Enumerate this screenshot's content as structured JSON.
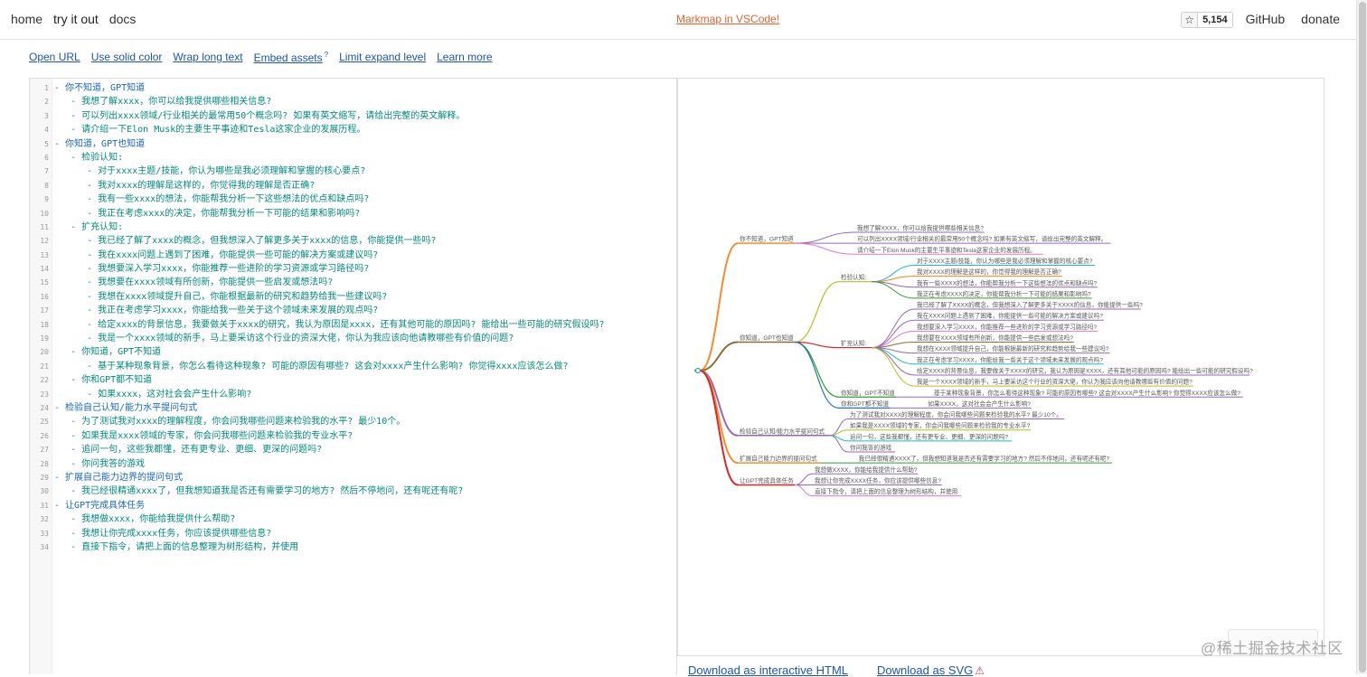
{
  "nav": {
    "left": [
      "home",
      "try it out",
      "docs"
    ],
    "center_link": "Markmap in VSCode!",
    "star_count": "5,154",
    "right": [
      "GitHub",
      "donate"
    ]
  },
  "toolbar": {
    "items": [
      "Open URL",
      "Use solid color",
      "Wrap long text",
      "Embed assets",
      "Limit expand level",
      "Learn more"
    ],
    "embed_badge": "?"
  },
  "editor": {
    "lines": [
      {
        "n": "1",
        "indent": 0,
        "text": "你不知道，GPT知道"
      },
      {
        "n": "2",
        "indent": 1,
        "text": "我想了解xxxx，你可以给我提供哪些相关信息?"
      },
      {
        "n": "3",
        "indent": 1,
        "text": "可以列出xxxx领域/行业相关的最常用50个概念吗? 如果有英文缩写，请给出完整的英文解释。"
      },
      {
        "n": "4",
        "indent": 1,
        "text": "请介绍一下Elon Musk的主要生平事迹和Tesla这家企业的发展历程。"
      },
      {
        "n": "5",
        "indent": 0,
        "text": "你知道，GPT也知道"
      },
      {
        "n": "6",
        "indent": 1,
        "text": "检验认知:"
      },
      {
        "n": "7",
        "indent": 2,
        "text": "对于xxxx主题/技能，你认为哪些是我必须理解和掌握的核心要点?"
      },
      {
        "n": "8",
        "indent": 2,
        "text": "我对xxxx的理解是这样的，你觉得我的理解是否正确?"
      },
      {
        "n": "9",
        "indent": 2,
        "text": "我有一些xxxx的想法，你能帮我分析一下这些想法的优点和缺点吗?"
      },
      {
        "n": "10",
        "indent": 2,
        "text": "我正在考虑xxxx的决定，你能帮我分析一下可能的结果和影响吗?"
      },
      {
        "n": "11",
        "indent": 1,
        "text": "扩充认知:"
      },
      {
        "n": "12",
        "indent": 2,
        "text": "我已经了解了xxxx的概念，但我想深入了解更多关于xxxx的信息，你能提供一些吗?"
      },
      {
        "n": "13",
        "indent": 2,
        "text": "我在xxxx问题上遇到了困难，你能提供一些可能的解决方案或建议吗?"
      },
      {
        "n": "14",
        "indent": 2,
        "text": "我想要深入学习xxxx，你能推荐一些进阶的学习资源或学习路径吗?"
      },
      {
        "n": "15",
        "indent": 2,
        "text": "我想要在xxxx领域有所创新，你能提供一些启发或想法吗?"
      },
      {
        "n": "16",
        "indent": 2,
        "text": "我想在xxxx领域提升自己，你能根据最新的研究和趋势给我一些建议吗?"
      },
      {
        "n": "17",
        "indent": 2,
        "text": "我正在考虑学习xxxx，你能给我一些关于这个领域未来发展的观点吗?"
      },
      {
        "n": "18",
        "indent": 2,
        "text": "给定xxxx的背景信息，我要做关于xxxx的研究，我认为原因是xxxx，还有其他可能的原因吗? 能给出一些可能的研究假设吗?"
      },
      {
        "n": "19",
        "indent": 2,
        "text": "我是一个xxxx领域的新手，马上要采访这个行业的资深大佬，你认为我应该向他请教哪些有价值的问题?"
      },
      {
        "n": "20",
        "indent": 1,
        "text": "你知道，GPT不知道"
      },
      {
        "n": "21",
        "indent": 2,
        "text": "基于某种现象背景，你怎么看待这种现象? 可能的原因有哪些? 这会对xxxx产生什么影响? 你觉得xxxx应该怎么做?"
      },
      {
        "n": "22",
        "indent": 1,
        "text": "你和GPT都不知道"
      },
      {
        "n": "23",
        "indent": 2,
        "text": "如果xxxx，这对社会会产生什么影响?"
      },
      {
        "n": "24",
        "indent": 0,
        "text": "检验自己认知/能力水平提问句式"
      },
      {
        "n": "25",
        "indent": 1,
        "text": "为了测试我对xxxx的理解程度，你会问我哪些问题来检验我的水平? 最少10个。"
      },
      {
        "n": "26",
        "indent": 1,
        "text": "如果我是xxxx领域的专家，你会问我哪些问题来检验我的专业水平?"
      },
      {
        "n": "27",
        "indent": 1,
        "text": "追问一句，这些我都懂，还有更专业、更细、更深的问题吗?"
      },
      {
        "n": "28",
        "indent": 1,
        "text": "你问我答的游戏"
      },
      {
        "n": "29",
        "indent": 0,
        "text": "扩展自己能力边界的提问句式"
      },
      {
        "n": "30",
        "indent": 1,
        "text": "我已经很精通xxxx了，但我想知道我是否还有需要学习的地方? 然后不停地问，还有呢还有呢?"
      },
      {
        "n": "31",
        "indent": 0,
        "text": "让GPT完成具体任务"
      },
      {
        "n": "32",
        "indent": 1,
        "text": "我想做xxxx，你能给我提供什么帮助?"
      },
      {
        "n": "33",
        "indent": 1,
        "text": "我想让你完成xxxx任务，你应该提供哪些信息?"
      },
      {
        "n": "34",
        "indent": 1,
        "text": "直接下指令，请把上面的信息整理为树形结构，并使用"
      }
    ]
  },
  "mindmap": {
    "colors": {
      "b1": "#f28e2c",
      "b2": "#8c6d31",
      "b3": "#9467bd",
      "b4": "#d62728",
      "b5": "#bcbd22",
      "leaf_a": "#e377c2",
      "leaf_b": "#17becf",
      "leaf_c": "#9467bd",
      "leaf_d": "#2ca02c",
      "leaf_e": "#1f77b4",
      "leaf_f": "#ff7f0e"
    },
    "branches": [
      {
        "label": "你不知道，GPT知道",
        "color": "#f28e2c",
        "leaves": [
          {
            "label": "我想了解XXXX，你可以给我提供哪些相关信息?",
            "color": "#9467bd"
          },
          {
            "label": "可以列出XXXX领域/行业相关的最常用50个概念吗? 如果有英文缩写，请给出完整的英文解释。",
            "color": "#9467bd"
          },
          {
            "label": "请介绍一下Elon Musk的主要生平事迹和Tesla这家企业的发展历程。",
            "color": "#e377c2"
          }
        ]
      },
      {
        "label": "你知道，GPT也知道",
        "color": "#8c6d31",
        "subs": [
          {
            "label": "检验认知:",
            "color": "#bcbd22",
            "leaves": [
              {
                "label": "对于XXXX主题/技能，你认为哪些是我必须理解和掌握的核心要点?",
                "color": "#17becf"
              },
              {
                "label": "我对XXXX的理解是这样的，你觉得我的理解是否正确?",
                "color": "#ff7f0e"
              },
              {
                "label": "我有一些XXXX的想法，你能帮我分析一下这些想法的优点和缺点吗?",
                "color": "#9467bd"
              },
              {
                "label": "我正在考虑XXXX的决定，你能帮我分析一下可能的结果和影响吗?",
                "color": "#2ca02c"
              }
            ]
          },
          {
            "label": "扩充认知:",
            "color": "#d62728",
            "leaves": [
              {
                "label": "我已经了解了XXXX的概念，但我想深入了解更多关于XXXX的信息，你能提供一些吗?",
                "color": "#9467bd"
              },
              {
                "label": "我在XXXX问题上遇到了困难，你能提供一些可能的解决方案或建议吗?",
                "color": "#9467bd"
              },
              {
                "label": "我想要深入学习XXXX，你能推荐一些进阶的学习资源或学习路径吗?",
                "color": "#e377c2"
              },
              {
                "label": "我想要在XXXX领域有所创新，你能提供一些启发或想法吗?",
                "color": "#8c6d31"
              },
              {
                "label": "我想在XXXX领域提升自己，你能根据最新的研究和趋势给我一些建议吗?",
                "color": "#9467bd"
              },
              {
                "label": "我正在考虑学习XXXX，你能给我一些关于这个领域未来发展的观点吗?",
                "color": "#17becf"
              },
              {
                "label": "给定XXXX的背景信息，我要做关于XXXX的研究，我认为原因是XXXX，还有其他可能的原因吗? 能给出一些可能的研究假设吗?",
                "color": "#9467bd"
              },
              {
                "label": "我是一个XXXX领域的新手，马上要采访这个行业的资深大佬，你认为我应该向他请教哪些有价值的问题?",
                "color": "#bcbd22"
              }
            ]
          },
          {
            "label": "你知道，GPT不知道",
            "color": "#2ca02c",
            "leaves": [
              {
                "label": "基于某种现象背景，你怎么看待这种现象? 可能的原因有哪些? 这会对XXXX产生什么影响? 你觉得XXXX应该怎么做?",
                "color": "#9467bd"
              }
            ]
          },
          {
            "label": "你和GPT都不知道",
            "color": "#1f77b4",
            "leaves": [
              {
                "label": "如果XXXX，这对社会会产生什么影响?",
                "color": "#9467bd"
              }
            ]
          }
        ]
      },
      {
        "label": "检验自己认知/能力水平提问句式",
        "color": "#9467bd",
        "leaves": [
          {
            "label": "为了测试我对XXXX的理解程度，你会问我哪些问题来检验我的水平? 最少10个。",
            "color": "#9467bd"
          },
          {
            "label": "如果我是XXXX领域的专家，你会问我哪些问题来检验我的专业水平?",
            "color": "#bcbd22"
          },
          {
            "label": "追问一句，这些我都懂，还有更专业、更细、更深的问题吗?",
            "color": "#17becf"
          },
          {
            "label": "你问我答的游戏",
            "color": "#9467bd"
          }
        ]
      },
      {
        "label": "扩展自己能力边界的提问句式",
        "color": "#f28e2c",
        "leaves": [
          {
            "label": "我已经很精通XXXX了，但我想知道我是否还有需要学习的地方? 然后不停地问，还有呢还有呢?",
            "color": "#2ca02c"
          }
        ]
      },
      {
        "label": "让GPT完成具体任务",
        "color": "#d62728",
        "leaves": [
          {
            "label": "我想做XXXX，你能给我提供什么帮助?",
            "color": "#9467bd"
          },
          {
            "label": "我想让你完成XXXX任务，你应该提供哪些信息?",
            "color": "#9467bd"
          },
          {
            "label": "直接下指令，请把上面的信息整理为树形结构，并使用",
            "color": "#e377c2"
          }
        ]
      }
    ]
  },
  "downloads": [
    "Download as interactive HTML",
    "Download as SVG"
  ],
  "watermark": "@稀土掘金技术社区"
}
